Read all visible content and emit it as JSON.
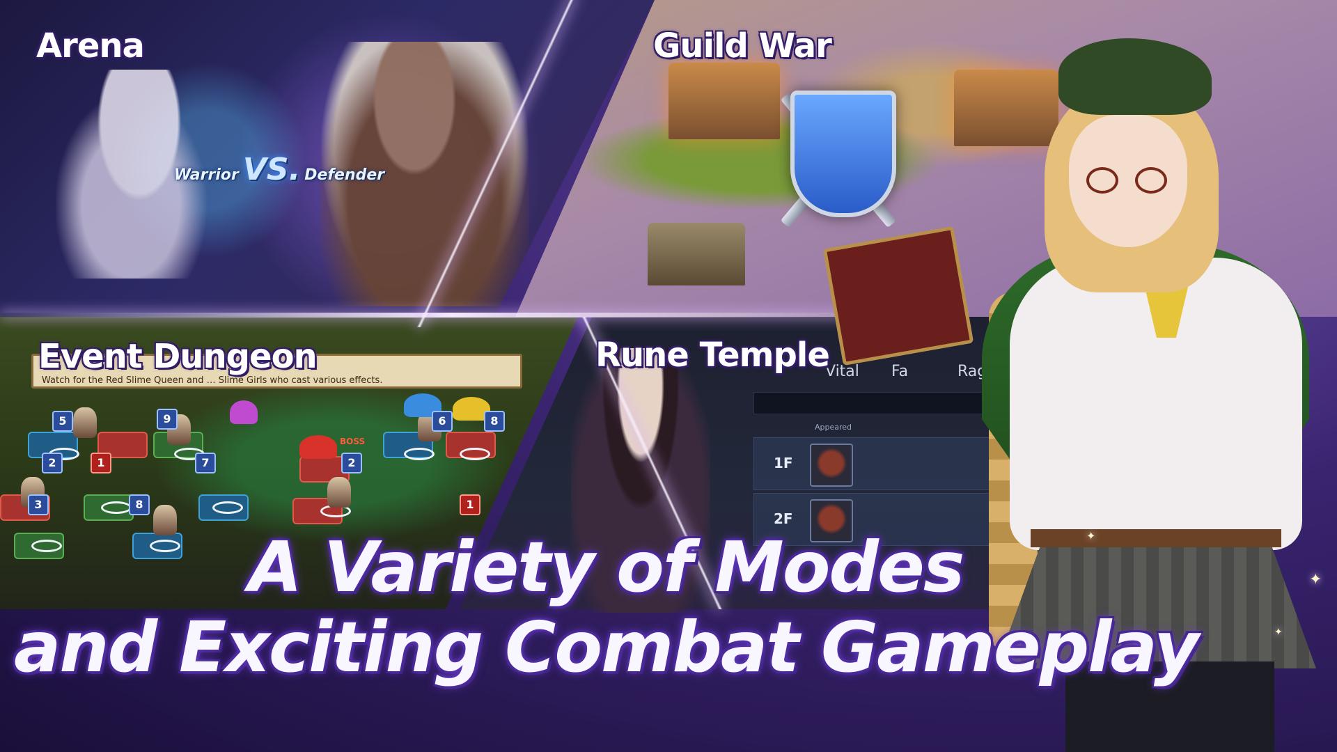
{
  "modes": {
    "arena": {
      "label": "Arena",
      "vs_left": "Warrior",
      "vs_mark": "VS.",
      "vs_right": "Defender"
    },
    "guild_war": {
      "label": "Guild War"
    },
    "event_dungeon": {
      "label": "Event Dungeon",
      "quest_text": "Watch for the Red Slime Queen and … Slime Girls who cast various effects.",
      "boss_tag": "BOSS",
      "badges": [
        "5",
        "9",
        "6",
        "8",
        "2",
        "1",
        "7",
        "2",
        "3",
        "8",
        "1"
      ]
    },
    "rune_temple": {
      "label": "Rune Temple",
      "tabs": [
        "Vital",
        "Fa",
        "Rag"
      ],
      "appeared_label": "Appeared",
      "floors": [
        "1F",
        "2F"
      ]
    }
  },
  "headline": {
    "line1": "A Variety of Modes",
    "line2": "and Exciting Combat Gameplay"
  },
  "colors": {
    "accent_purple": "#6a3ccf",
    "cape_green": "#2e6a2a",
    "shield_blue": "#2a5cc8"
  }
}
